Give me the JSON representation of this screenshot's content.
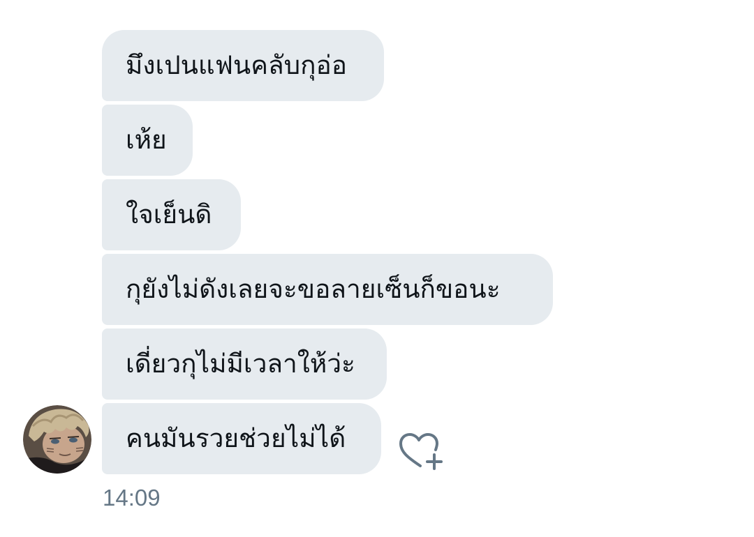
{
  "conversation": {
    "messages": [
      {
        "text": "มึงเปนแฟนคลับกุอ่อ"
      },
      {
        "text": "เห้ย"
      },
      {
        "text": "ใจเย็นดิ"
      },
      {
        "text": "กุยังไม่ดังเลยจะขอลายเซ็นก็ขอนะ"
      },
      {
        "text": "เดี่ยวกุไม่มีเวลาให้ว่ะ"
      },
      {
        "text": "คนมันรวยช่วยไม่ได้"
      }
    ],
    "timestamp": "14:09",
    "avatar_icon": "user-avatar",
    "reaction_icon": "heart-plus-icon"
  },
  "colors": {
    "bubble_background": "#e6ebef",
    "text": "#0f1419",
    "muted_text": "#657786"
  }
}
